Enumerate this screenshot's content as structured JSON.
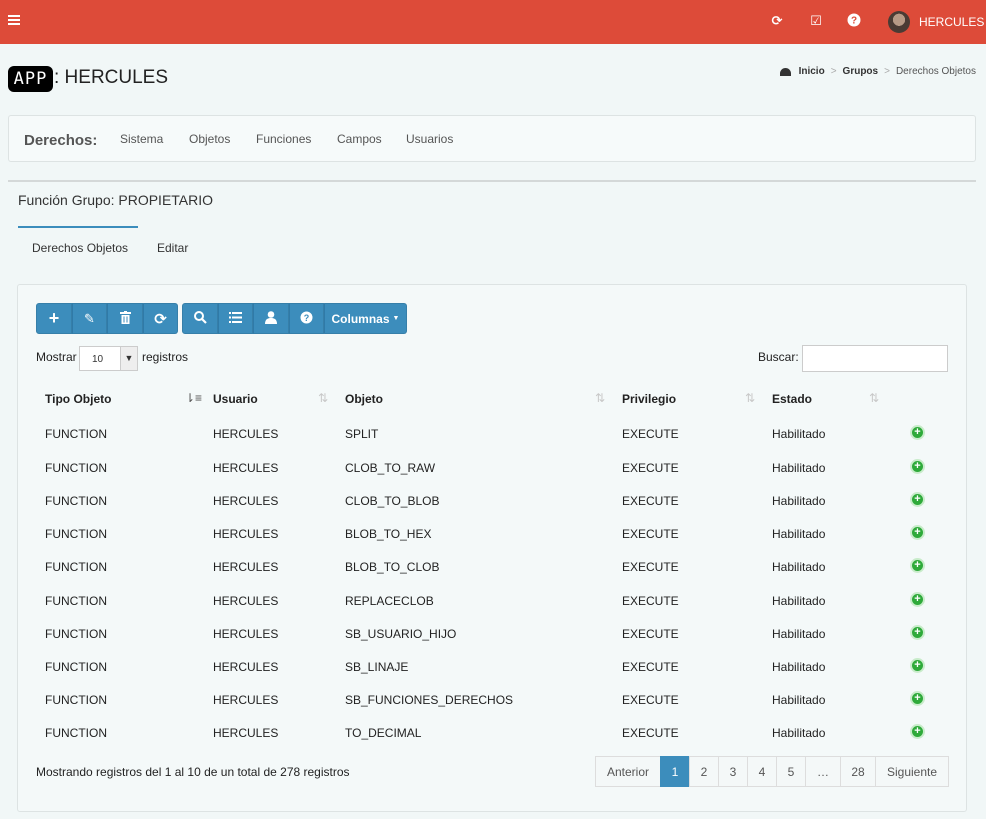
{
  "topbar": {
    "username": "HERCULES",
    "icons": [
      "refresh-icon",
      "check-square-icon",
      "help-icon"
    ]
  },
  "header": {
    "logo_text": "APP",
    "title": ": HERCULES",
    "breadcrumb": [
      "Inicio",
      "Grupos",
      "Derechos Objetos"
    ]
  },
  "derechos": {
    "label": "Derechos:",
    "items": [
      "Sistema",
      "Objetos",
      "Funciones",
      "Campos",
      "Usuarios"
    ]
  },
  "function_title": "Función Grupo: PROPIETARIO",
  "tabs": [
    "Derechos Objetos",
    "Editar"
  ],
  "toolbar": {
    "columns_label": "Columnas"
  },
  "length": {
    "prefix": "Mostrar",
    "value": "10",
    "suffix": "registros"
  },
  "search": {
    "label": "Buscar:",
    "value": ""
  },
  "table": {
    "headers": [
      "Tipo Objeto",
      "Usuario",
      "Objeto",
      "Privilegio",
      "Estado"
    ],
    "rows": [
      [
        "FUNCTION",
        "HERCULES",
        "SPLIT",
        "EXECUTE",
        "Habilitado"
      ],
      [
        "FUNCTION",
        "HERCULES",
        "CLOB_TO_RAW",
        "EXECUTE",
        "Habilitado"
      ],
      [
        "FUNCTION",
        "HERCULES",
        "CLOB_TO_BLOB",
        "EXECUTE",
        "Habilitado"
      ],
      [
        "FUNCTION",
        "HERCULES",
        "BLOB_TO_HEX",
        "EXECUTE",
        "Habilitado"
      ],
      [
        "FUNCTION",
        "HERCULES",
        "BLOB_TO_CLOB",
        "EXECUTE",
        "Habilitado"
      ],
      [
        "FUNCTION",
        "HERCULES",
        "REPLACECLOB",
        "EXECUTE",
        "Habilitado"
      ],
      [
        "FUNCTION",
        "HERCULES",
        "SB_USUARIO_HIJO",
        "EXECUTE",
        "Habilitado"
      ],
      [
        "FUNCTION",
        "HERCULES",
        "SB_LINAJE",
        "EXECUTE",
        "Habilitado"
      ],
      [
        "FUNCTION",
        "HERCULES",
        "SB_FUNCIONES_DERECHOS",
        "EXECUTE",
        "Habilitado"
      ],
      [
        "FUNCTION",
        "HERCULES",
        "TO_DECIMAL",
        "EXECUTE",
        "Habilitado"
      ]
    ]
  },
  "footer": {
    "info": "Mostrando registros del 1 al 10 de un total de 278 registros",
    "pagination": [
      "Anterior",
      "1",
      "2",
      "3",
      "4",
      "5",
      "…",
      "28",
      "Siguiente"
    ],
    "active_page": "1"
  },
  "colors": {
    "topbar": "#dd4b39",
    "primary": "#3c8dbc",
    "success": "#2eaa3a"
  }
}
